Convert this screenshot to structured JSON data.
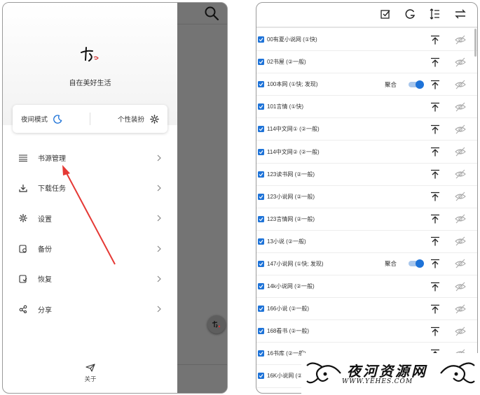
{
  "drawer": {
    "slogan": "自在美好生活",
    "night_mode_label": "夜间模式",
    "theme_label": "个性装扮",
    "menu": [
      {
        "label": "书源管理",
        "icon": "list-icon"
      },
      {
        "label": "下载任务",
        "icon": "download-icon"
      },
      {
        "label": "设置",
        "icon": "gear-icon"
      },
      {
        "label": "备份",
        "icon": "backup-icon"
      },
      {
        "label": "恢复",
        "icon": "restore-icon"
      },
      {
        "label": "分享",
        "icon": "share-icon"
      }
    ],
    "about_label": "关于"
  },
  "annotation": {
    "arrow_color": "#e53935"
  },
  "toolbar": {
    "icons": [
      "checkbox-edit-icon",
      "g-icon",
      "sort-icon",
      "swap-icon"
    ]
  },
  "sources": [
    {
      "name": "00有夏小说网 (①快)",
      "checked": true
    },
    {
      "name": "02书屋 (②一般)",
      "checked": true
    },
    {
      "name": "100本网 (①快; 发现)",
      "checked": true,
      "aggregate": "聚合"
    },
    {
      "name": "101言情 (①快)",
      "checked": true
    },
    {
      "name": "114中文网① (②一般)",
      "checked": true
    },
    {
      "name": "114中文网② (②一般)",
      "checked": true
    },
    {
      "name": "123读书网 (②一般)",
      "checked": true
    },
    {
      "name": "123小说网 (②一般)",
      "checked": true
    },
    {
      "name": "123言情网 (②一般)",
      "checked": true
    },
    {
      "name": "13小说 (②一般)",
      "checked": true
    },
    {
      "name": "147小说网 (①快; 发现)",
      "checked": true,
      "aggregate": "聚合"
    },
    {
      "name": "14k小说网 (②一般)",
      "checked": true
    },
    {
      "name": "166小说 (②一般)",
      "checked": true
    },
    {
      "name": "168看书 (②一般)",
      "checked": true
    },
    {
      "name": "16书库 (②一般)",
      "checked": true
    },
    {
      "name": "16K小说网 (②一般)",
      "checked": true
    }
  ],
  "colors": {
    "accent": "#1e73d8",
    "overlay": "#747474"
  },
  "watermark": {
    "text": "夜河资源网",
    "url": "WWW.YEHES.COM"
  }
}
